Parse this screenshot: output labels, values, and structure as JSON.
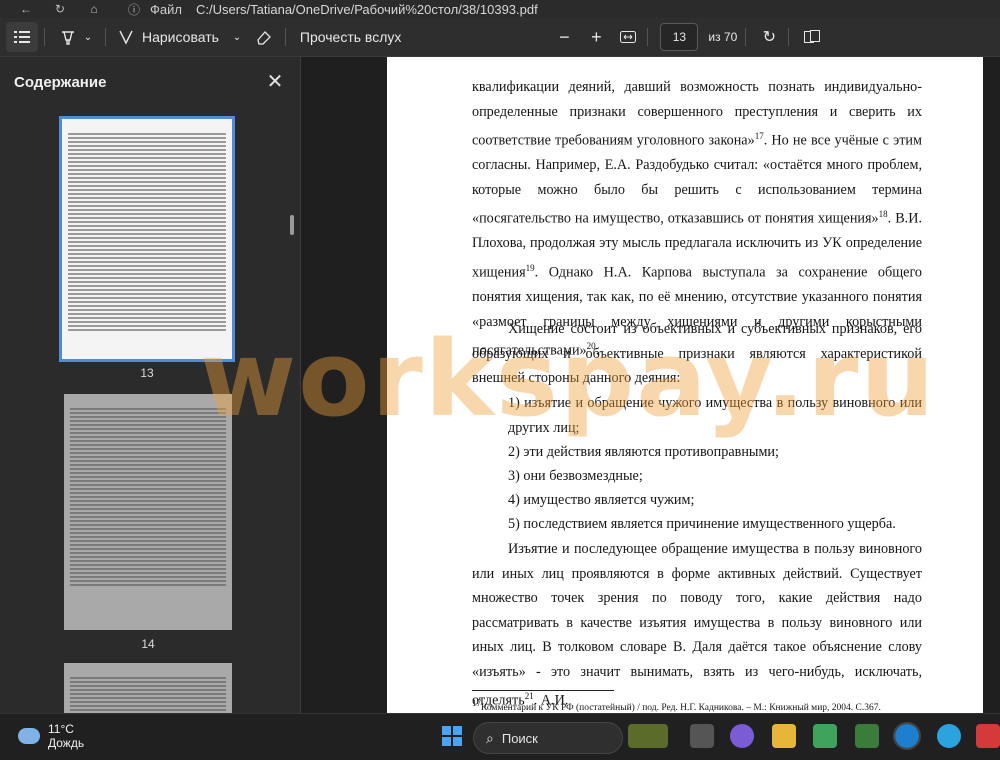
{
  "address_bar": {
    "file_label": "Файл",
    "path": "C:/Users/Tatiana/OneDrive/Рабочий%20стол/38/10393.pdf"
  },
  "toolbar": {
    "draw_label": "Нарисовать",
    "read_aloud_label": "Прочесть вслух",
    "page_current": "13",
    "page_total": "из 70"
  },
  "sidebar": {
    "title": "Содержание",
    "thumbnails": [
      {
        "page": "13"
      },
      {
        "page": "14"
      }
    ]
  },
  "document": {
    "lines": [
      "квалификации деяний, давший возможность познать индивидуально-определенные признаки совершенного преступления и сверить их соответствие требованиям уголовного закона»",
      "17",
      ". Но не все учёные с этим согласны. Например, Е.А. Раздобудько считал: «остаётся много проблем, которые можно было бы решить с использованием термина «посягательство на имущество, отказавшись от понятия хищения»",
      "18",
      ". В.И. Плохова, продолжая эту мысль предлагала исключить из УК определение хищения",
      "19",
      ". Однако Н.А. Карпова выступала за сохранение общего понятия хищения, так как, по её мнению, отсутствие указанного понятия «размоет границы между хищениями и другими корыстными посягательствами»",
      "20",
      "."
    ],
    "para2": "Хищение состоит из объективных и субъективных признаков, его образующих и объективные признаки являются характеристикой внешней стороны данного деяния:",
    "list": [
      "1) изъятие и обращение чужого имущества в пользу виновного или других лиц;",
      "2) эти действия являются противоправными;",
      "3) они безвозмездные;",
      "4) имущество является чужим;",
      "5) последствием является причинение имущественного ущерба."
    ],
    "para3_text": "Изъятие и последующее обращение имущества в пользу виновного или иных лиц проявляются в форме активных действий. Существует множество точек зрения по поводу того, какие действия надо рассматривать в качестве изъятия имущества в пользу виновного или иных лиц. В толковом словаре В. Даля даётся такое объяснение слову «изъять» - это значит вынимать, взять из чего-нибудь, исключать, отделять",
    "para3_sup": "21",
    "para3_tail": ". А.И.",
    "footnote": "Комментарий к УК РФ (постатейный) / под. Ред. Н.Г. Кадникова. – М.: Книжный мир, 2004. С.367.",
    "footnote_num": "17"
  },
  "watermark": "workspay.ru",
  "taskbar": {
    "temp": "11°C",
    "weather": "Дождь",
    "search_placeholder": "Поиск"
  }
}
